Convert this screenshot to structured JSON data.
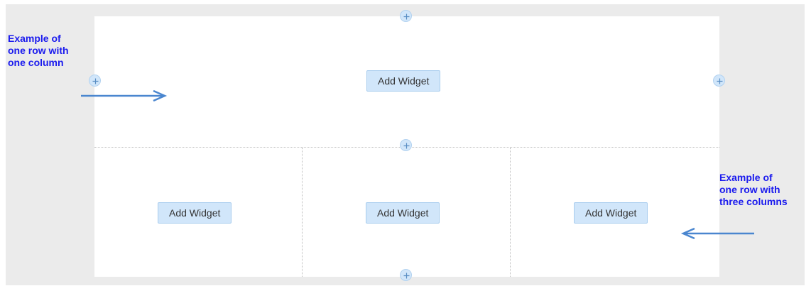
{
  "rows": [
    {
      "columns": [
        {
          "button_label": "Add Widget"
        }
      ]
    },
    {
      "columns": [
        {
          "button_label": "Add Widget"
        },
        {
          "button_label": "Add Widget"
        },
        {
          "button_label": "Add Widget"
        }
      ]
    }
  ],
  "annotations": {
    "one_column": [
      "Example of",
      "one row with",
      "one column"
    ],
    "three_columns": [
      "Example of",
      "one row with",
      "three columns"
    ]
  },
  "icons": {
    "add": "plus-icon",
    "pointer": "arrow-icon"
  },
  "colors": {
    "annotation_text": "#1a1aee",
    "arrow": "#4a86cf",
    "button_fill": "#d1e6fa",
    "workspace_background": "#ebebeb"
  }
}
